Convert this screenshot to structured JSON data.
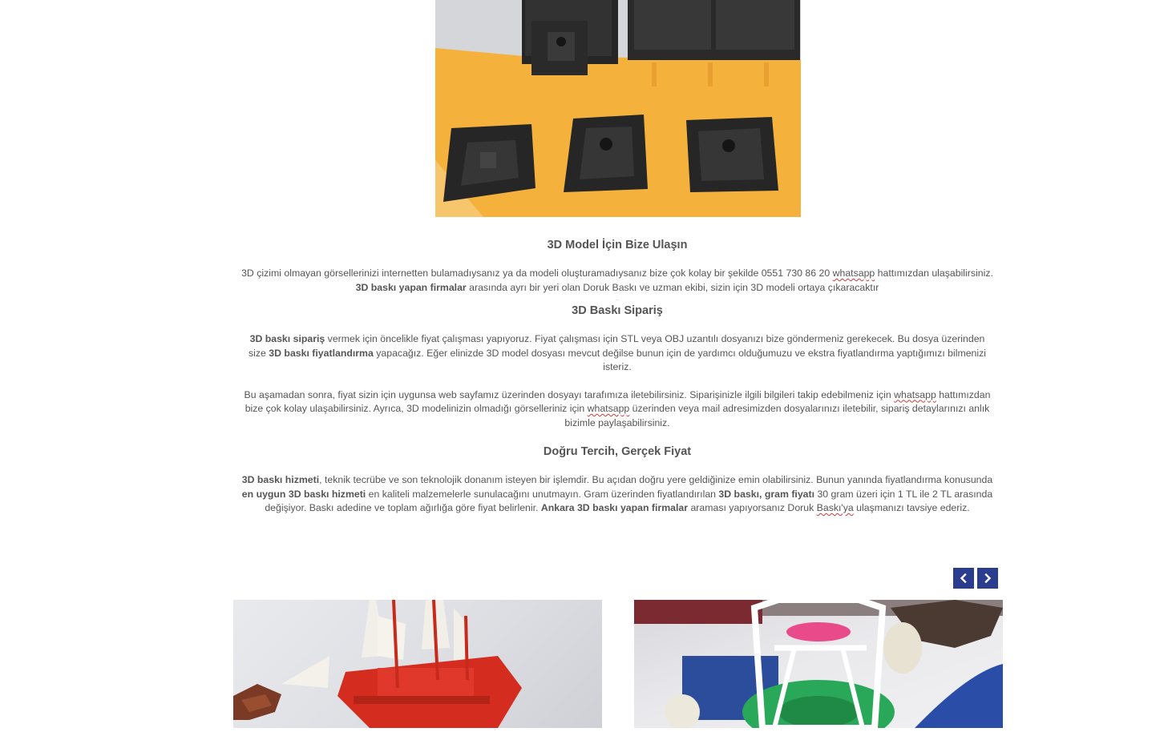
{
  "hero": {
    "image": "3d-printed-black-tiles-photo"
  },
  "sections": [
    {
      "heading": "3D Model İçin Bize Ulaşın",
      "p1_a": "3D çizimi olmayan görsellerinizi internetten bulamadıysanız ya da modeli oluşturamadıysanız bize çok kolay bir şekilde 0551 730 86 20 ",
      "p1_wa": "whatsapp",
      "p1_b": " hattımızdan ulaşabilirsiniz. ",
      "p1_bold": "3D baskı yapan firmalar",
      "p1_c": " arasında ayrı bir yeri olan Doruk Baskı ve uzman ekibi, sizin için 3D modeli ortaya çıkaracaktır",
      "sep": "."
    },
    {
      "heading": "3D Baskı Sipariş",
      "p1_bold1": "3D baskı sipariş",
      "p1_a": " vermek için öncelikle fiyat çalışması yapıyoruz. Fiyat çalışması için STL veya OBJ uzantılı dosyanızı bize göndermeniz gerekecek. Bu dosya üzerinden size ",
      "p1_bold2": "3D baskı fiyatlandırma",
      "p1_b": " yapacağız. Eğer elinizde 3D model dosyası mevcut değilse bunun için de yardımcı olduğumuzu ve ekstra fiyatlandırma yaptığımızı bilmenizi isteriz.",
      "p2_a": "Bu aşamadan sonra, fiyat sizin için uygunsa web sayfamız üzerinden dosyayı tarafımıza iletebilirsiniz. Siparişinizle ilgili bilgileri takip edebilmeniz için ",
      "p2_wa1": "whatsapp",
      "p2_b": " hattımızdan bize çok kolay ulaşabilirsiniz. Ayrıca, 3D modelinizin olmadığı görselleriniz için ",
      "p2_wa2": "whatsapp",
      "p2_c": " üzerinden veya mail adresimizden dosyalarınızı iletebilir, sipariş detaylarınızı anlık bizimle paylaşabilirsiniz."
    },
    {
      "heading": "Doğru Tercih, Gerçek Fiyat",
      "p1_bold1": "3D baskı hizmeti",
      "p1_a": ", teknik tecrübe ve son teknolojik donanım isteyen bir işlemdir. Bu açıdan doğru yere geldiğinize emin olabilirsiniz. Bunun yanında fiyatlandırma konusunda ",
      "p1_bold2": "en uygun 3D baskı hizmeti",
      "p1_b": " en kaliteli malzemelerle sunulacağını unutmayın. Gram üzerinden fiyatlandırılan ",
      "p1_bold3": "3D baskı, gram fiyatı",
      "p1_c": " 30 gram üzeri için 1 TL ile 2 TL arasında değişiyor. Baskı adedine ve toplam ağırlığa göre fiyat belirlenir. ",
      "p1_bold4": "Ankara 3D baskı yapan firmalar",
      "p1_d": " araması yapıyorsanız Doruk ",
      "p1_wa": "Baskı'ya",
      "p1_e": " ulaşmanızı tavsiye ederiz."
    }
  ],
  "carousel": {
    "prev_icon": "chevron-left-icon",
    "next_icon": "chevron-right-icon",
    "accent": "#2b3d8f",
    "cards": [
      {
        "image": "red-3d-printed-ship-photo"
      },
      {
        "image": "white-3d-printed-frame-photo"
      }
    ]
  }
}
